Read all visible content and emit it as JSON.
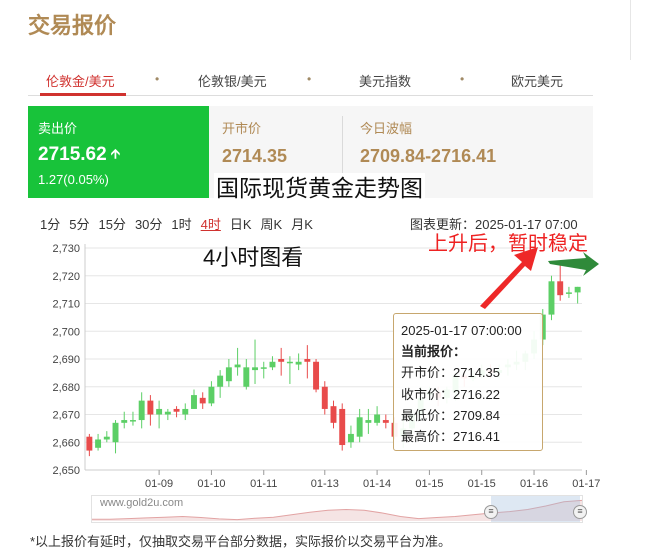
{
  "page": {
    "title": "交易报价"
  },
  "tabs": [
    {
      "label": "伦敦金/美元",
      "active": true
    },
    {
      "label": "伦敦银/美元",
      "active": false
    },
    {
      "label": "美元指数",
      "active": false
    },
    {
      "label": "欧元美元",
      "active": false
    }
  ],
  "tab_separator": "•",
  "quote": {
    "sell_label": "卖出价",
    "sell_value": "2715.62",
    "sell_change": "1.27(0.05%)",
    "open_label": "开市价",
    "open_value": "2714.35",
    "range_label": "今日波幅",
    "range_value": "2709.84-2716.41"
  },
  "overlay": {
    "title": "国际现货黄金走势图",
    "subtitle": "4小时图看",
    "annotation": "上升后，暂时稳定"
  },
  "periods": [
    {
      "label": "1分",
      "active": false
    },
    {
      "label": "5分",
      "active": false
    },
    {
      "label": "15分",
      "active": false
    },
    {
      "label": "30分",
      "active": false
    },
    {
      "label": "1时",
      "active": false
    },
    {
      "label": "4时",
      "active": true
    },
    {
      "label": "日K",
      "active": false
    },
    {
      "label": "周K",
      "active": false
    },
    {
      "label": "月K",
      "active": false
    }
  ],
  "chart_update": "图表更新：2025-01-17 07:00",
  "tooltip": {
    "time": "2025-01-17 07:00:00",
    "current_label": "当前报价：",
    "open": "开市价：2714.35",
    "close": "收市价：2716.22",
    "low": "最低价：2709.84",
    "high": "最高价：2716.41"
  },
  "navigator": {
    "site": "www.gold2u.com",
    "handle_glyph": "≡"
  },
  "footnote": "*以上报价有延时，仅抽取交易平台部分数据，实际报价以交易平台为准。",
  "colors": {
    "up": "#5ccf66",
    "down": "#e84b4b",
    "accent": "#b08a55",
    "tab_active": "#d0322f",
    "sell_bg": "#18c33a"
  },
  "chart_data": {
    "type": "candlestick",
    "ylim": [
      2650,
      2730
    ],
    "yticks": [
      "2,650",
      "2,660",
      "2,670",
      "2,680",
      "2,690",
      "2,700",
      "2,710",
      "2,720",
      "2,730"
    ],
    "xticks": [
      {
        "label": "01-09",
        "index": 8
      },
      {
        "label": "01-10",
        "index": 14
      },
      {
        "label": "01-11",
        "index": 20
      },
      {
        "label": "01-13",
        "index": 27
      },
      {
        "label": "01-14",
        "index": 33
      },
      {
        "label": "01-15",
        "index": 39
      },
      {
        "label": "01-15",
        "index": 45
      },
      {
        "label": "01-16",
        "index": 51
      },
      {
        "label": "01-17",
        "index": 57
      }
    ],
    "candles": [
      [
        2662,
        2657,
        2663,
        2655
      ],
      [
        2658,
        2661,
        2663,
        2657
      ],
      [
        2661,
        2662,
        2664,
        2660
      ],
      [
        2660,
        2667,
        2668,
        2656
      ],
      [
        2667,
        2668,
        2671,
        2665
      ],
      [
        2668,
        2668,
        2671,
        2666
      ],
      [
        2668,
        2675,
        2678,
        2665
      ],
      [
        2675,
        2670,
        2677,
        2666
      ],
      [
        2670,
        2672,
        2675,
        2665
      ],
      [
        2670,
        2671,
        2672,
        2668
      ],
      [
        2672,
        2671,
        2673,
        2669
      ],
      [
        2670,
        2672,
        2674,
        2668
      ],
      [
        2672,
        2677,
        2679,
        2672
      ],
      [
        2676,
        2674,
        2678,
        2672
      ],
      [
        2674,
        2680,
        2682,
        2673
      ],
      [
        2680,
        2684,
        2686,
        2676
      ],
      [
        2682,
        2687,
        2690,
        2680
      ],
      [
        2687,
        2688,
        2694,
        2684
      ],
      [
        2680,
        2687,
        2690,
        2679
      ],
      [
        2686,
        2687,
        2697,
        2681
      ],
      [
        2687,
        2687,
        2689,
        2683
      ],
      [
        2687,
        2689,
        2691,
        2686
      ],
      [
        2690,
        2689,
        2694,
        2684
      ],
      [
        2689,
        2689,
        2691,
        2681
      ],
      [
        2688,
        2689,
        2692,
        2686
      ],
      [
        2690,
        2689,
        2695,
        2683
      ],
      [
        2689,
        2679,
        2690,
        2678
      ],
      [
        2680,
        2672,
        2682,
        2670
      ],
      [
        2673,
        2667,
        2675,
        2665
      ],
      [
        2672,
        2659,
        2674,
        2657
      ],
      [
        2660,
        2663,
        2666,
        2658
      ],
      [
        2662,
        2669,
        2672,
        2660
      ],
      [
        2667,
        2668,
        2672,
        2663
      ],
      [
        2667,
        2670,
        2673,
        2666
      ],
      [
        2668,
        2667,
        2670,
        2665
      ],
      [
        2667,
        2662,
        2669,
        2661
      ],
      [
        2662,
        2665,
        2670,
        2658
      ],
      [
        2665,
        2670,
        2672,
        2663
      ],
      [
        2670,
        2676,
        2680,
        2668
      ],
      [
        2677,
        2678,
        2680,
        2675
      ],
      [
        2678,
        2676,
        2680,
        2673
      ],
      [
        2676,
        2679,
        2680,
        2674
      ],
      [
        2678,
        2684,
        2685,
        2675
      ],
      [
        2684,
        2683,
        2686,
        2680
      ],
      [
        2683,
        2684,
        2686,
        2682
      ],
      [
        2684,
        2686,
        2688,
        2683
      ],
      [
        2686,
        2685,
        2688,
        2683
      ],
      [
        2685,
        2686,
        2688,
        2683
      ],
      [
        2687,
        2688,
        2690,
        2684
      ],
      [
        2688,
        2689,
        2693,
        2686
      ],
      [
        2689,
        2692,
        2693,
        2686
      ],
      [
        2692,
        2697,
        2700,
        2690
      ],
      [
        2697,
        2706,
        2708,
        2695
      ],
      [
        2706,
        2718,
        2720,
        2704
      ],
      [
        2718,
        2713,
        2724,
        2711
      ],
      [
        2714,
        2714,
        2716,
        2712
      ],
      [
        2714,
        2716,
        2716,
        2710
      ]
    ],
    "navigator_trend": [
      2662,
      2662,
      2664,
      2666,
      2668,
      2670,
      2667,
      2663,
      2661,
      2665,
      2668,
      2675,
      2682,
      2688,
      2690,
      2688,
      2680,
      2670,
      2664,
      2667,
      2670,
      2675,
      2680,
      2684,
      2690,
      2700,
      2712,
      2716
    ]
  }
}
